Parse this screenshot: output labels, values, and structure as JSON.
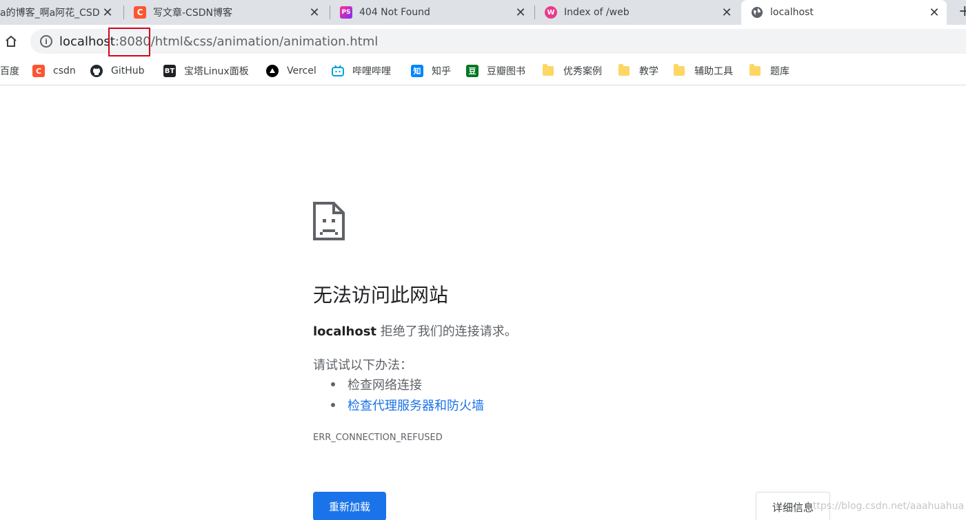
{
  "tabs": [
    {
      "title": "a的博客_啊a阿花_CSD",
      "favicon": "",
      "active": false
    },
    {
      "title": "写文章-CSDN博客",
      "favicon": "C",
      "active": false
    },
    {
      "title": "404 Not Found",
      "favicon": "PS",
      "active": false
    },
    {
      "title": "Index of /web",
      "favicon": "W",
      "active": false
    },
    {
      "title": "localhost",
      "favicon": "globe-icon",
      "active": true
    }
  ],
  "close_glyph": "✕",
  "newtab_glyph": "+",
  "address": {
    "host": "localhost",
    "rest": ":8080/html&css/animation/animation.html"
  },
  "bookmarks": [
    {
      "label": "百度",
      "icon": ""
    },
    {
      "label": "csdn",
      "icon": "C"
    },
    {
      "label": "GitHub",
      "icon": "github-icon"
    },
    {
      "label": "宝塔Linux面板",
      "icon": "BT"
    },
    {
      "label": "Vercel",
      "icon": "vercel-icon"
    },
    {
      "label": "哔哩哔哩",
      "icon": "bilibili-icon"
    },
    {
      "label": "知乎",
      "icon": "知"
    },
    {
      "label": "豆瓣图书",
      "icon": "豆"
    },
    {
      "label": "优秀案例",
      "icon": "folder-icon"
    },
    {
      "label": "教学",
      "icon": "folder-icon"
    },
    {
      "label": "辅助工具",
      "icon": "folder-icon"
    },
    {
      "label": "题库",
      "icon": "folder-icon"
    }
  ],
  "error": {
    "title": "无法访问此网站",
    "host": "localhost",
    "message": " 拒绝了我们的连接请求。",
    "try_label": "请试试以下办法：",
    "suggestions": [
      "检查网络连接",
      "检查代理服务器和防火墙"
    ],
    "code": "ERR_CONNECTION_REFUSED",
    "reload_label": "重新加载",
    "details_label": "详细信息"
  },
  "watermark": "https://blog.csdn.net/aaahuahua",
  "colors": {
    "accent": "#1a73e8",
    "highlight": "#d0021b",
    "csdn": "#fc5531"
  }
}
